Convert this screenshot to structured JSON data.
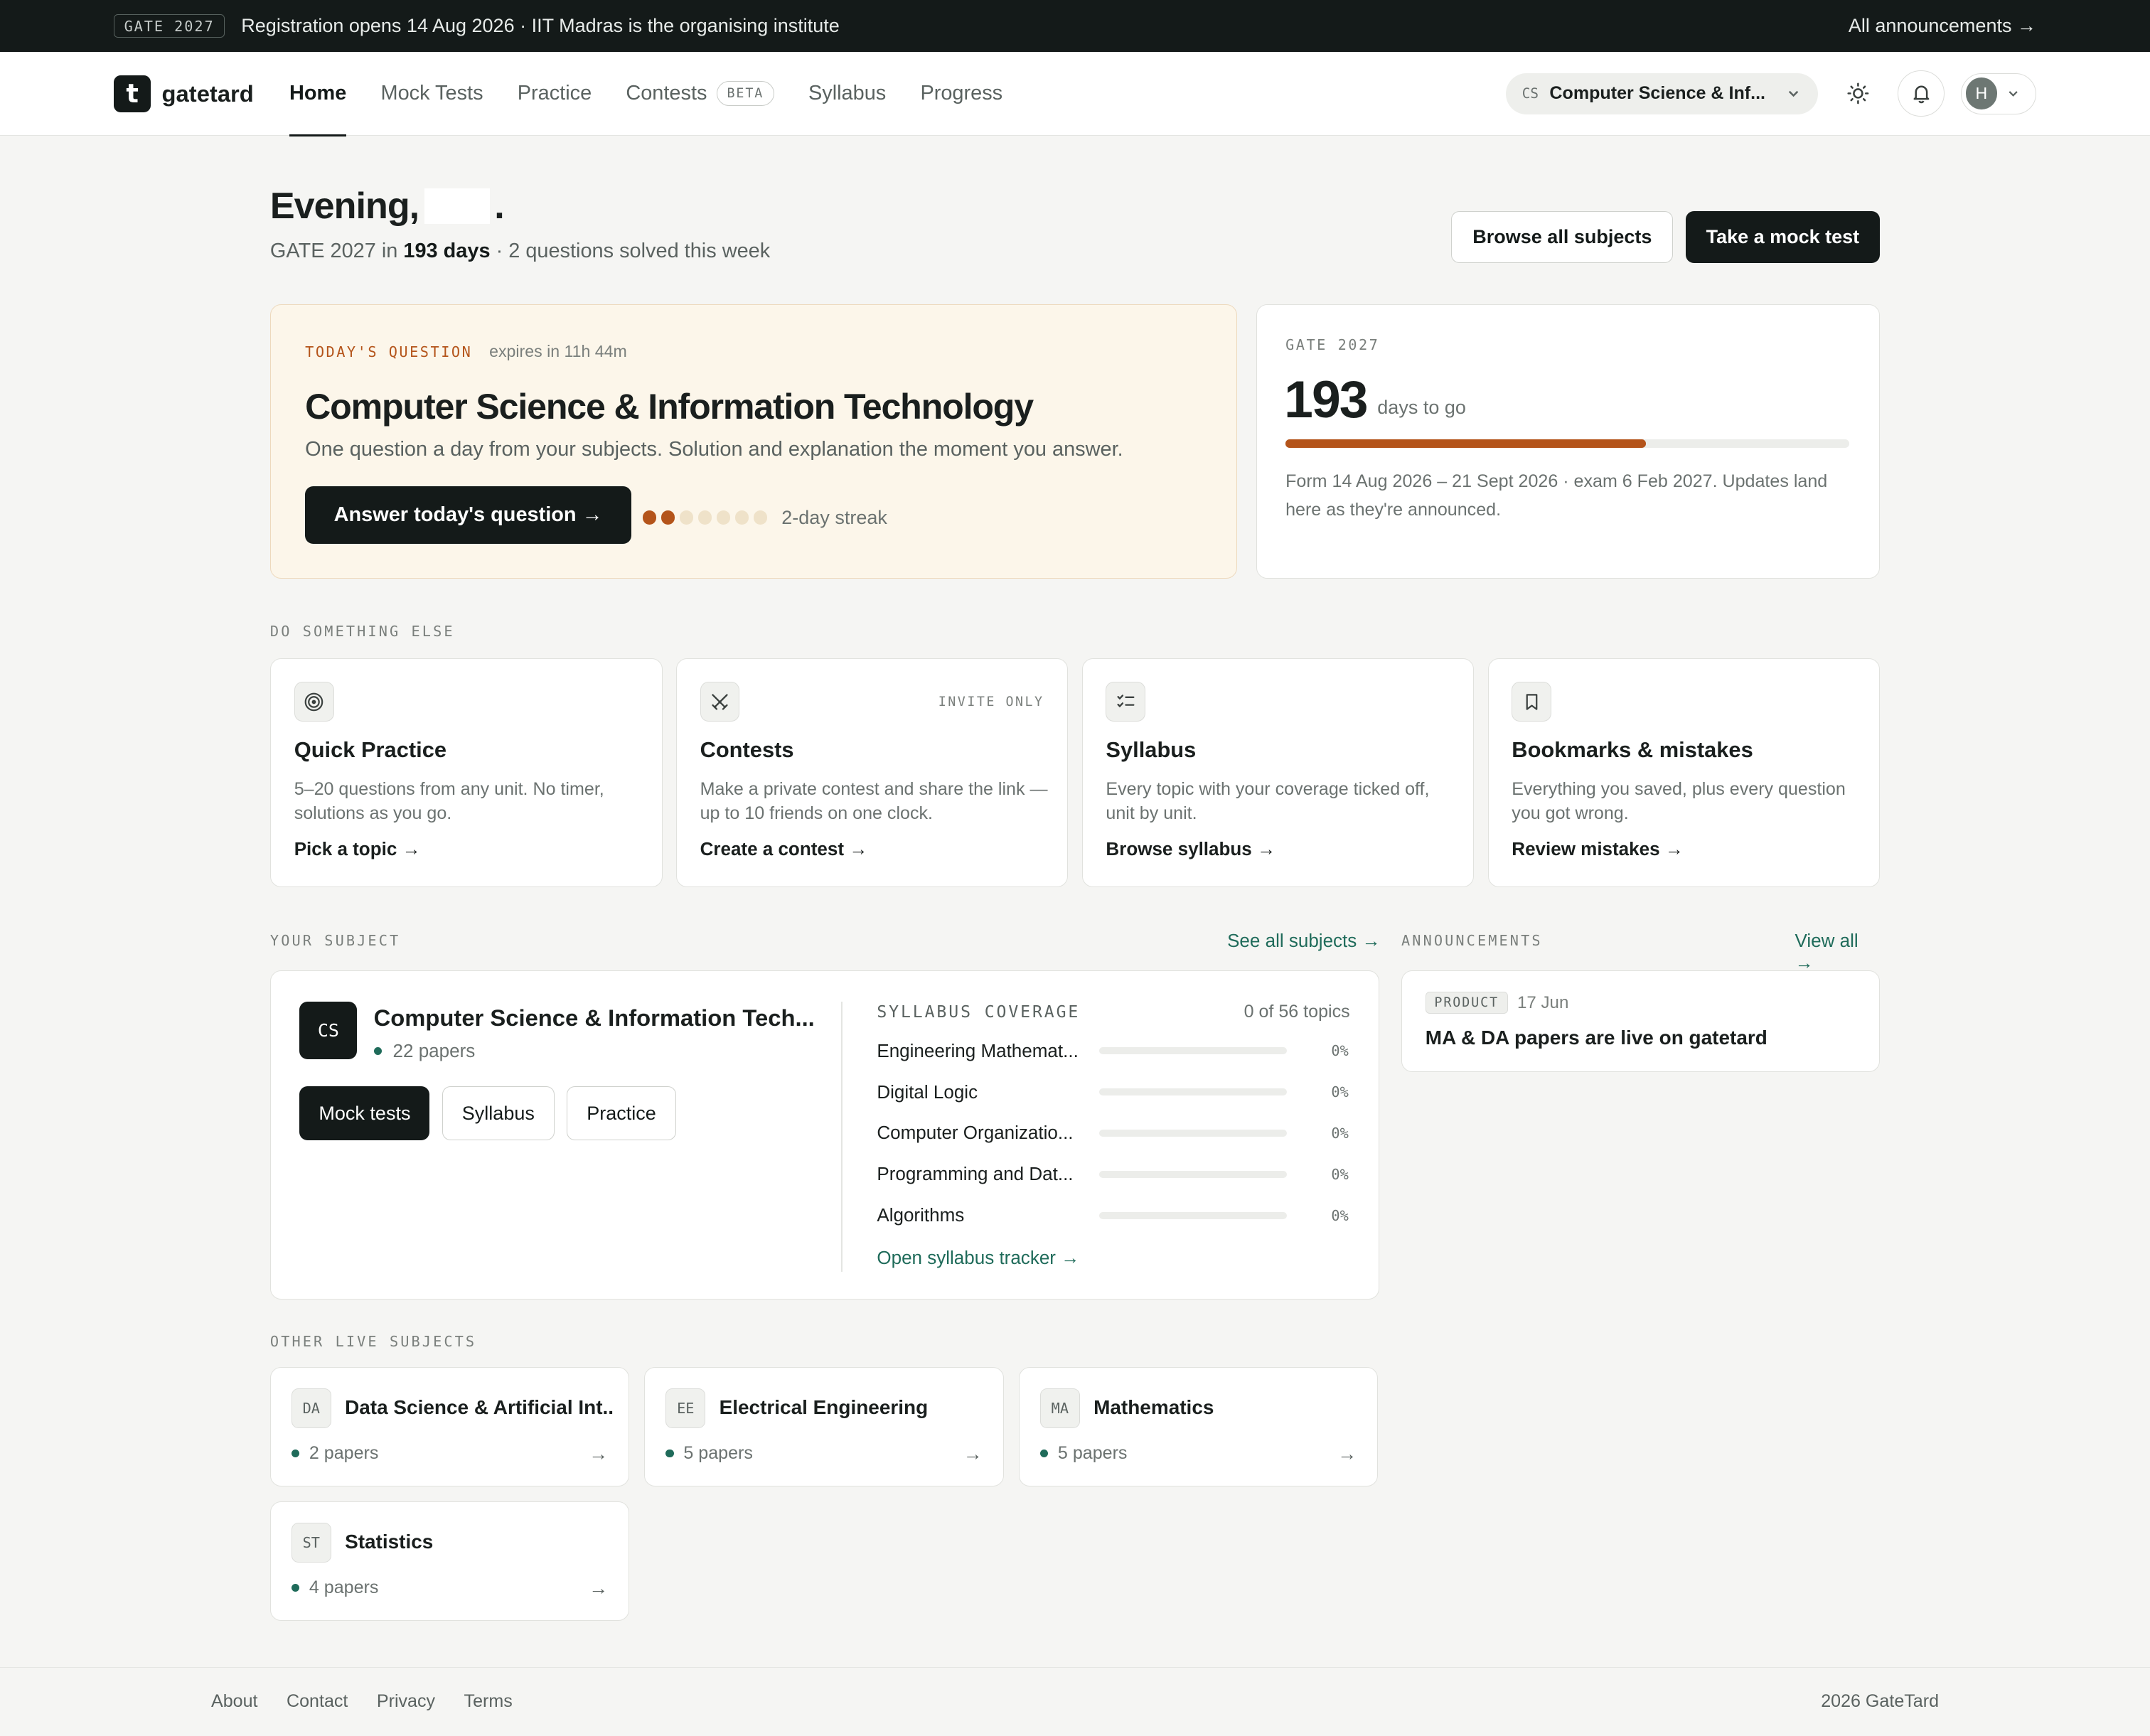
{
  "announcement_bar": {
    "tag": "GATE 2027",
    "text": "Registration opens 14 Aug 2026 · IIT Madras is the organising institute",
    "link": "All announcements →"
  },
  "nav": {
    "logo_letter": "t",
    "brand": "gatetard",
    "links": [
      "Home",
      "Mock Tests",
      "Practice",
      "Contests",
      "Syllabus",
      "Progress"
    ],
    "active": "Home",
    "contests_badge": "BETA",
    "subject_code": "CS",
    "subject_label": "Computer Science & Inf...",
    "avatar_initial": "H",
    "icons": [
      "chevron-down-icon",
      "sun-icon",
      "bell-icon"
    ]
  },
  "hero": {
    "greeting_prefix": "Evening,",
    "greeting_suffix": ".",
    "subline_prefix": "GATE 2027 in",
    "days_bold": "193 days",
    "subline_suffix": "· 2 questions solved this week",
    "browse_label": "Browse all subjects",
    "mock_label": "Take a mock test"
  },
  "todays_question": {
    "label": "TODAY'S QUESTION",
    "expires": "expires in 11h 44m",
    "title": "Computer Science & Information Technology",
    "description": "One question a day from your subjects. Solution and explanation the moment you answer.",
    "button": "Answer today's question →",
    "streak_days": 2,
    "streak_total": 7,
    "streak_label": "2-day streak"
  },
  "countdown": {
    "label": "GATE 2027",
    "days": "193",
    "unit": "days to go",
    "progress": 0.64,
    "note": "Form 14 Aug 2026 – 21 Sept 2026 · exam 6 Feb 2027. Updates land here as they're announced.",
    "accent_color": "#b4541a"
  },
  "do_something_else": {
    "label": "DO SOMETHING ELSE",
    "tiles": [
      {
        "icon": "target-icon",
        "badge": "",
        "title": "Quick Practice",
        "desc": "5–20 questions from any unit. No timer, solutions as you go.",
        "cta": "Pick a topic →"
      },
      {
        "icon": "swords-icon",
        "badge": "INVITE ONLY",
        "title": "Contests",
        "desc": "Make a private contest and share the link — up to 10 friends on one clock.",
        "cta": "Create a contest →"
      },
      {
        "icon": "checklist-icon",
        "badge": "",
        "title": "Syllabus",
        "desc": "Every topic with your coverage ticked off, unit by unit.",
        "cta": "Browse syllabus →"
      },
      {
        "icon": "bookmark-icon",
        "badge": "",
        "title": "Bookmarks & mistakes",
        "desc": "Everything you saved, plus every question you got wrong.",
        "cta": "Review mistakes →"
      }
    ]
  },
  "your_subject": {
    "label": "YOUR SUBJECT",
    "link": "See all subjects →",
    "code": "CS",
    "name": "Computer Science & Information Tech...",
    "papers": "22 papers",
    "buttons": [
      "Mock tests",
      "Syllabus",
      "Practice"
    ],
    "coverage_title": "SYLLABUS COVERAGE",
    "coverage_count": "0 of 56 topics",
    "coverage": [
      {
        "name": "Engineering Mathemat...",
        "pct": "0%",
        "value": 0
      },
      {
        "name": "Digital Logic",
        "pct": "0%",
        "value": 0
      },
      {
        "name": "Computer Organizatio...",
        "pct": "0%",
        "value": 0
      },
      {
        "name": "Programming and Dat...",
        "pct": "0%",
        "value": 0
      },
      {
        "name": "Algorithms",
        "pct": "0%",
        "value": 0
      }
    ],
    "tracker_link": "Open syllabus tracker →"
  },
  "announcements": {
    "label": "ANNOUNCEMENTS",
    "link": "View all →",
    "items": [
      {
        "tag": "PRODUCT",
        "date": "17 Jun",
        "title": "MA & DA papers are live on gatetard"
      }
    ]
  },
  "other_subjects": {
    "label": "OTHER LIVE SUBJECTS",
    "items": [
      {
        "code": "DA",
        "name": "Data Science & Artificial Int...",
        "papers": "2 papers",
        "arrow": "→"
      },
      {
        "code": "EE",
        "name": "Electrical Engineering",
        "papers": "5 papers",
        "arrow": "→"
      },
      {
        "code": "MA",
        "name": "Mathematics",
        "papers": "5 papers",
        "arrow": "→"
      },
      {
        "code": "ST",
        "name": "Statistics",
        "papers": "4 papers",
        "arrow": "→"
      }
    ]
  },
  "footer": {
    "links": [
      "About",
      "Contact",
      "Privacy",
      "Terms"
    ],
    "copyright": "2026 GateTard"
  }
}
